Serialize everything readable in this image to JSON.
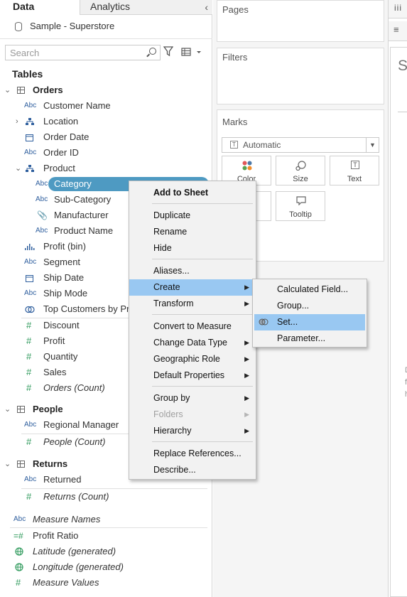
{
  "tabs": {
    "data": "Data",
    "analytics": "Analytics"
  },
  "source": "Sample - Superstore",
  "search": {
    "placeholder": "Search"
  },
  "tables_header": "Tables",
  "tree": {
    "orders": "Orders",
    "customer_name": "Customer Name",
    "location": "Location",
    "order_date": "Order Date",
    "order_id": "Order ID",
    "product": "Product",
    "category": "Category",
    "sub_category": "Sub-Category",
    "manufacturer": "Manufacturer",
    "product_name": "Product Name",
    "profit_bin": "Profit (bin)",
    "segment": "Segment",
    "ship_date": "Ship Date",
    "ship_mode": "Ship Mode",
    "top_customers": "Top Customers by Pro",
    "discount": "Discount",
    "profit": "Profit",
    "quantity": "Quantity",
    "sales": "Sales",
    "orders_count": "Orders (Count)",
    "people": "People",
    "regional_manager": "Regional Manager",
    "people_count": "People (Count)",
    "returns": "Returns",
    "returned": "Returned",
    "returns_count": "Returns (Count)",
    "measure_names": "Measure Names",
    "profit_ratio": "Profit Ratio",
    "latitude": "Latitude (generated)",
    "longitude": "Longitude (generated)",
    "measure_values": "Measure Values"
  },
  "icons": {
    "abc": "Abc",
    "hash": "#",
    "chevron_right": "›",
    "chevron_down": "⌄"
  },
  "shelves": {
    "pages": "Pages",
    "filters": "Filters",
    "marks": "Marks",
    "mark_type": "Automatic",
    "color": "Color",
    "size": "Size",
    "text": "Text",
    "tooltip": "Tooltip"
  },
  "right_partial": {
    "title": "Sl",
    "hint1": "D",
    "hint2": "f",
    "hint3": "h"
  },
  "context_menu": {
    "add_to_sheet": "Add to Sheet",
    "duplicate": "Duplicate",
    "rename": "Rename",
    "hide": "Hide",
    "aliases": "Aliases...",
    "create": "Create",
    "transform": "Transform",
    "convert_to_measure": "Convert to Measure",
    "change_data_type": "Change Data Type",
    "geographic_role": "Geographic Role",
    "default_properties": "Default Properties",
    "group_by": "Group by",
    "folders": "Folders",
    "hierarchy": "Hierarchy",
    "replace_references": "Replace References...",
    "describe": "Describe..."
  },
  "create_submenu": {
    "calculated_field": "Calculated Field...",
    "group": "Group...",
    "set": "Set...",
    "parameter": "Parameter..."
  },
  "colors": {
    "selection": "#4e9ac2",
    "menu_highlight": "#99c8f2"
  }
}
